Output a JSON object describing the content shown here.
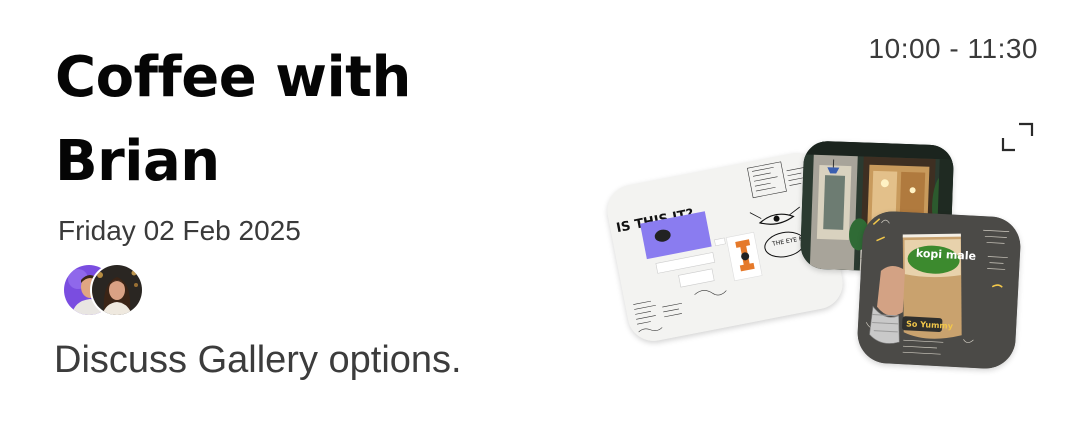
{
  "event": {
    "title": "Coffee with Brian",
    "time_range": "10:00 - 11:30",
    "date": "Friday 02 Feb 2025",
    "description": "Discuss Gallery options."
  },
  "attendees": [
    {
      "name": "attendee-1",
      "icon": "avatar-man-purple-background"
    },
    {
      "name": "attendee-2",
      "icon": "avatar-woman-night-background"
    }
  ],
  "gallery": {
    "images": [
      {
        "subject": "moodboard-sketch",
        "text_top": "IS THIS IT?",
        "text_tag": "THE EYE KNOWS"
      },
      {
        "subject": "cafe-storefront"
      },
      {
        "subject": "iced-coffee-cup",
        "brand_text": "kopi male",
        "caption": "So Yummy"
      }
    ]
  },
  "actions": {
    "expand_icon": "expand-corners-icon"
  },
  "colors": {
    "title": "#050505",
    "body_text": "#3a3a3a",
    "moodboard_accent": "#8a7cf0",
    "moodboard_orange": "#e5792a",
    "cup_badge_green": "#3c8a2e"
  }
}
